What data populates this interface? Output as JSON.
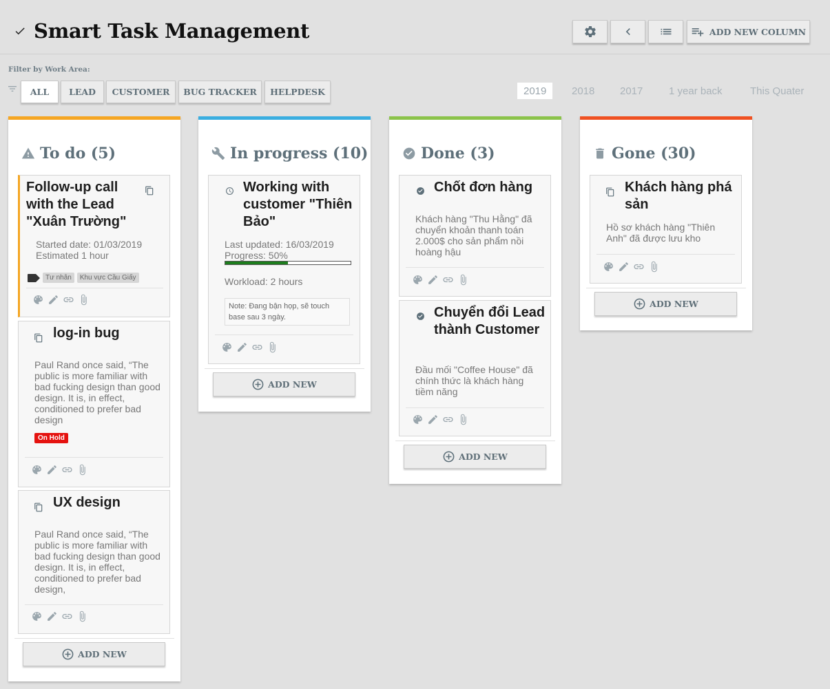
{
  "app": {
    "title": "Smart Task Management"
  },
  "toolbar": {
    "add_column_label": "ADD NEW COLUMN"
  },
  "filter": {
    "label": "Filter by Work Area:",
    "areas": [
      "ALL",
      "LEAD",
      "CUSTOMER",
      "BUG TRACKER",
      "HELPDESK"
    ],
    "active_area": "ALL",
    "periods": [
      "2019",
      "2018",
      "2017",
      "1 year back",
      "This Quater"
    ],
    "active_period": "2019"
  },
  "colors": {
    "todo": "#f5a623",
    "in_progress": "#3aaee0",
    "done": "#8bc34a",
    "gone": "#ef5122"
  },
  "columns": {
    "todo": {
      "title": "To do (5)",
      "cards": [
        {
          "title": "Follow-up call with the Lead \"Xuân Trường\"",
          "started": "Started date: 01/03/2019",
          "estimate": "Estimated 1 hour",
          "tags": [
            "Tư nhân",
            "Khu vực Cầu Giấy"
          ]
        },
        {
          "title": "log-in bug",
          "text": "Paul Rand once said, “The public is more familiar with bad fucking design than good design. It is, in effect, conditioned to prefer bad design",
          "badge": "On Hold"
        },
        {
          "title": "UX design",
          "text": "Paul Rand once said, “The public is more familiar with bad fucking design than good design. It is, in effect, conditioned to prefer bad design,"
        }
      ],
      "add_label": "ADD NEW"
    },
    "in_progress": {
      "title": "In progress (10)",
      "cards": [
        {
          "title": "Working with customer \"Thiên Bảo\"",
          "updated": "Last updated: 16/03/2019",
          "progress_label": "Progress: 50%",
          "progress": 0.5,
          "workload": "Workload: 2 hours",
          "note": "Note: Đang bận họp, sẽ touch base sau 3 ngày."
        }
      ],
      "add_label": "ADD NEW"
    },
    "done": {
      "title": "Done (3)",
      "cards": [
        {
          "title": "Chốt đơn hàng",
          "text": "Khách hàng \"Thu Hằng\" đã chuyển khoản thanh toán 2.000$ cho sản phẩm nồi hoàng hậu"
        },
        {
          "title": "Chuyển đổi Lead thành Customer",
          "text": "Đầu mối \"Coffee House\" đã chính thức là khách hàng tiềm năng"
        }
      ],
      "add_label": "ADD NEW"
    },
    "gone": {
      "title": "Gone (30)",
      "cards": [
        {
          "title": "Khách hàng phá sản",
          "text": "Hồ sơ khách hàng \"Thiên Anh\" đã được lưu kho"
        }
      ],
      "add_label": "ADD NEW"
    }
  },
  "icons": {
    "header": [
      "check-icon",
      "gear-icon",
      "chevron-left-icon",
      "list-icon",
      "playlist-add-icon"
    ],
    "filter": "filter-icon",
    "columns": [
      "warning-icon",
      "wrench-icon",
      "check-circle-icon",
      "trash-icon"
    ],
    "card_actions": [
      "palette-icon",
      "pencil-icon",
      "link-icon",
      "paperclip-icon"
    ],
    "add": "plus-circle-icon"
  }
}
